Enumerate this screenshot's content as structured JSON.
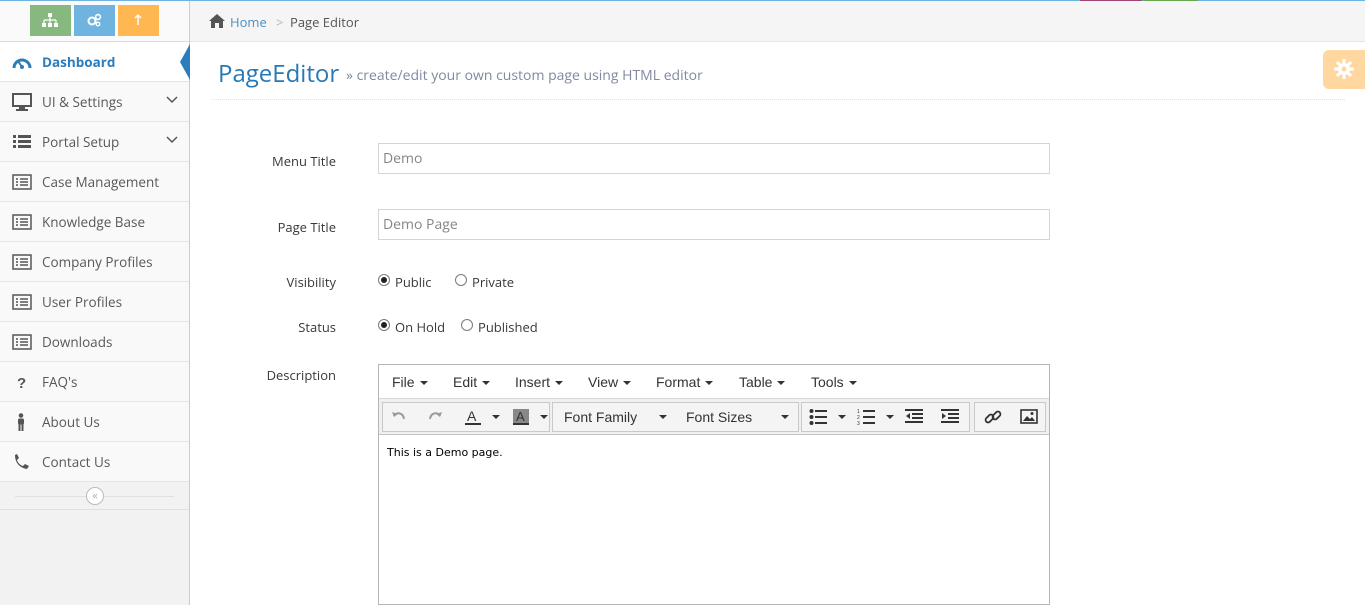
{
  "colors": {
    "primary": "#2b7dbc",
    "green": "#87b87f",
    "blue": "#6fb3e0",
    "orange": "#ffb752"
  },
  "shortcuts": [
    {
      "icon": "sitemap-icon"
    },
    {
      "icon": "cogs-icon"
    },
    {
      "icon": "upload-icon"
    }
  ],
  "sidebar": {
    "items": [
      {
        "label": "Dashboard",
        "icon": "dashboard-icon",
        "active": true
      },
      {
        "label": "UI & Settings",
        "icon": "desktop-icon",
        "submenu": true
      },
      {
        "label": "Portal Setup",
        "icon": "list-icon",
        "submenu": true
      },
      {
        "label": "Case Management",
        "icon": "list-alt-icon"
      },
      {
        "label": "Knowledge Base",
        "icon": "list-alt-icon"
      },
      {
        "label": "Company Profiles",
        "icon": "list-alt-icon"
      },
      {
        "label": "User Profiles",
        "icon": "list-alt-icon"
      },
      {
        "label": "Downloads",
        "icon": "list-alt-icon"
      },
      {
        "label": "FAQ's",
        "icon": "question-icon"
      },
      {
        "label": "About Us",
        "icon": "male-icon"
      },
      {
        "label": "Contact Us",
        "icon": "phone-icon"
      }
    ]
  },
  "breadcrumbs": {
    "home": "Home",
    "separator": ">",
    "current": "Page Editor"
  },
  "header": {
    "title": "PageEditor",
    "subtitle": "» create/edit your own custom page using HTML editor"
  },
  "form": {
    "menu_title_label": "Menu Title",
    "menu_title_value": "Demo",
    "page_title_label": "Page Title",
    "page_title_value": "Demo Page",
    "visibility_label": "Visibility",
    "visibility_options": [
      "Public",
      "Private"
    ],
    "visibility_selected": "Public",
    "status_label": "Status",
    "status_options": [
      "On Hold",
      "Published"
    ],
    "status_selected": "On Hold",
    "description_label": "Description"
  },
  "editor": {
    "menus": [
      "File",
      "Edit",
      "Insert",
      "View",
      "Format",
      "Table",
      "Tools"
    ],
    "font_family": "Font Family",
    "font_sizes": "Font Sizes",
    "content": "This is a Demo page."
  }
}
